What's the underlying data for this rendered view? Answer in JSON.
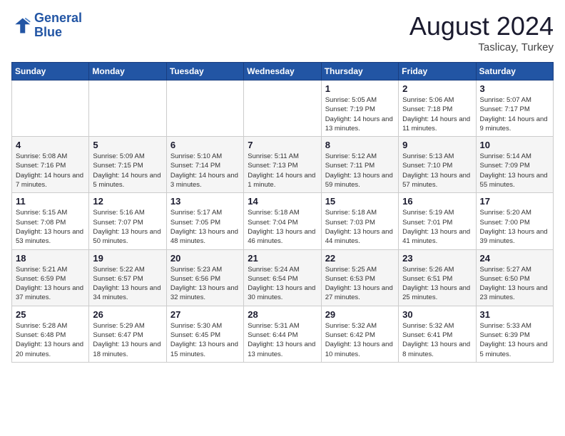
{
  "header": {
    "logo_line1": "General",
    "logo_line2": "Blue",
    "month_year": "August 2024",
    "location": "Taslicay, Turkey"
  },
  "weekdays": [
    "Sunday",
    "Monday",
    "Tuesday",
    "Wednesday",
    "Thursday",
    "Friday",
    "Saturday"
  ],
  "weeks": [
    [
      {
        "day": "",
        "info": ""
      },
      {
        "day": "",
        "info": ""
      },
      {
        "day": "",
        "info": ""
      },
      {
        "day": "",
        "info": ""
      },
      {
        "day": "1",
        "info": "Sunrise: 5:05 AM\nSunset: 7:19 PM\nDaylight: 14 hours\nand 13 minutes."
      },
      {
        "day": "2",
        "info": "Sunrise: 5:06 AM\nSunset: 7:18 PM\nDaylight: 14 hours\nand 11 minutes."
      },
      {
        "day": "3",
        "info": "Sunrise: 5:07 AM\nSunset: 7:17 PM\nDaylight: 14 hours\nand 9 minutes."
      }
    ],
    [
      {
        "day": "4",
        "info": "Sunrise: 5:08 AM\nSunset: 7:16 PM\nDaylight: 14 hours\nand 7 minutes."
      },
      {
        "day": "5",
        "info": "Sunrise: 5:09 AM\nSunset: 7:15 PM\nDaylight: 14 hours\nand 5 minutes."
      },
      {
        "day": "6",
        "info": "Sunrise: 5:10 AM\nSunset: 7:14 PM\nDaylight: 14 hours\nand 3 minutes."
      },
      {
        "day": "7",
        "info": "Sunrise: 5:11 AM\nSunset: 7:13 PM\nDaylight: 14 hours\nand 1 minute."
      },
      {
        "day": "8",
        "info": "Sunrise: 5:12 AM\nSunset: 7:11 PM\nDaylight: 13 hours\nand 59 minutes."
      },
      {
        "day": "9",
        "info": "Sunrise: 5:13 AM\nSunset: 7:10 PM\nDaylight: 13 hours\nand 57 minutes."
      },
      {
        "day": "10",
        "info": "Sunrise: 5:14 AM\nSunset: 7:09 PM\nDaylight: 13 hours\nand 55 minutes."
      }
    ],
    [
      {
        "day": "11",
        "info": "Sunrise: 5:15 AM\nSunset: 7:08 PM\nDaylight: 13 hours\nand 53 minutes."
      },
      {
        "day": "12",
        "info": "Sunrise: 5:16 AM\nSunset: 7:07 PM\nDaylight: 13 hours\nand 50 minutes."
      },
      {
        "day": "13",
        "info": "Sunrise: 5:17 AM\nSunset: 7:05 PM\nDaylight: 13 hours\nand 48 minutes."
      },
      {
        "day": "14",
        "info": "Sunrise: 5:18 AM\nSunset: 7:04 PM\nDaylight: 13 hours\nand 46 minutes."
      },
      {
        "day": "15",
        "info": "Sunrise: 5:18 AM\nSunset: 7:03 PM\nDaylight: 13 hours\nand 44 minutes."
      },
      {
        "day": "16",
        "info": "Sunrise: 5:19 AM\nSunset: 7:01 PM\nDaylight: 13 hours\nand 41 minutes."
      },
      {
        "day": "17",
        "info": "Sunrise: 5:20 AM\nSunset: 7:00 PM\nDaylight: 13 hours\nand 39 minutes."
      }
    ],
    [
      {
        "day": "18",
        "info": "Sunrise: 5:21 AM\nSunset: 6:59 PM\nDaylight: 13 hours\nand 37 minutes."
      },
      {
        "day": "19",
        "info": "Sunrise: 5:22 AM\nSunset: 6:57 PM\nDaylight: 13 hours\nand 34 minutes."
      },
      {
        "day": "20",
        "info": "Sunrise: 5:23 AM\nSunset: 6:56 PM\nDaylight: 13 hours\nand 32 minutes."
      },
      {
        "day": "21",
        "info": "Sunrise: 5:24 AM\nSunset: 6:54 PM\nDaylight: 13 hours\nand 30 minutes."
      },
      {
        "day": "22",
        "info": "Sunrise: 5:25 AM\nSunset: 6:53 PM\nDaylight: 13 hours\nand 27 minutes."
      },
      {
        "day": "23",
        "info": "Sunrise: 5:26 AM\nSunset: 6:51 PM\nDaylight: 13 hours\nand 25 minutes."
      },
      {
        "day": "24",
        "info": "Sunrise: 5:27 AM\nSunset: 6:50 PM\nDaylight: 13 hours\nand 23 minutes."
      }
    ],
    [
      {
        "day": "25",
        "info": "Sunrise: 5:28 AM\nSunset: 6:48 PM\nDaylight: 13 hours\nand 20 minutes."
      },
      {
        "day": "26",
        "info": "Sunrise: 5:29 AM\nSunset: 6:47 PM\nDaylight: 13 hours\nand 18 minutes."
      },
      {
        "day": "27",
        "info": "Sunrise: 5:30 AM\nSunset: 6:45 PM\nDaylight: 13 hours\nand 15 minutes."
      },
      {
        "day": "28",
        "info": "Sunrise: 5:31 AM\nSunset: 6:44 PM\nDaylight: 13 hours\nand 13 minutes."
      },
      {
        "day": "29",
        "info": "Sunrise: 5:32 AM\nSunset: 6:42 PM\nDaylight: 13 hours\nand 10 minutes."
      },
      {
        "day": "30",
        "info": "Sunrise: 5:32 AM\nSunset: 6:41 PM\nDaylight: 13 hours\nand 8 minutes."
      },
      {
        "day": "31",
        "info": "Sunrise: 5:33 AM\nSunset: 6:39 PM\nDaylight: 13 hours\nand 5 minutes."
      }
    ]
  ]
}
